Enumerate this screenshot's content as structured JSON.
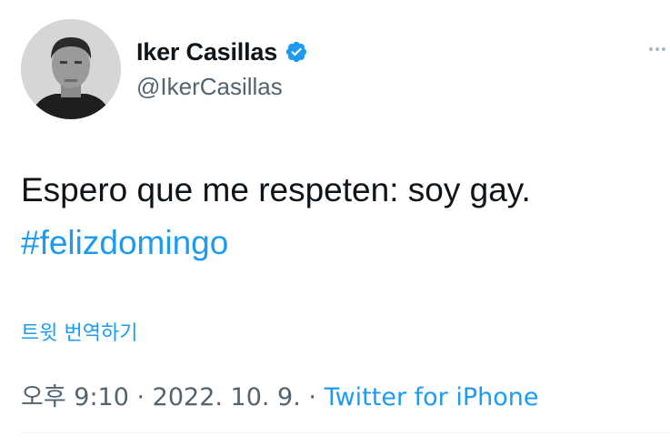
{
  "author": {
    "display_name": "Iker Casillas",
    "handle": "@IkerCasillas",
    "verified": true
  },
  "tweet": {
    "text_line1": "Espero que me respeten: soy gay.",
    "hashtag": "#felizdomingo"
  },
  "translate_label": "트윗 번역하기",
  "meta": {
    "time": "오후 9:10",
    "separator": " · ",
    "date": "2022. 10. 9.",
    "source": "Twitter for iPhone"
  },
  "colors": {
    "link": "#1d9bf0",
    "verified_badge": "#1d9bf0",
    "secondary_text": "#536471",
    "primary_text": "#0f1419"
  },
  "icons": {
    "verified": "verified-badge-icon",
    "more": "more-options-icon"
  }
}
